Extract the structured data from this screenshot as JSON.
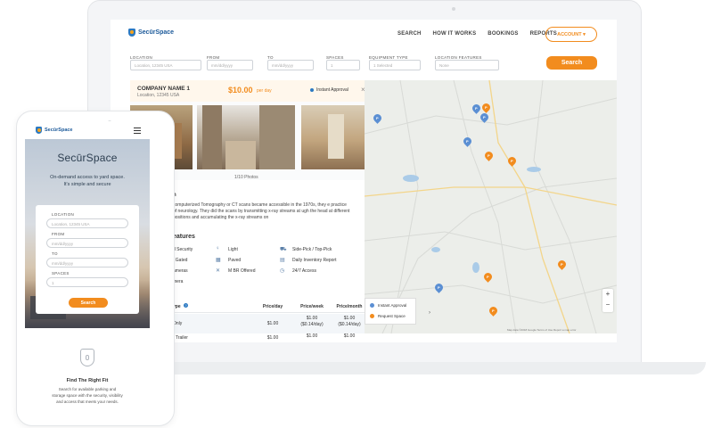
{
  "brand": {
    "name": "SecūrSpace",
    "hero_title": "SecūrSpace",
    "accent": "#f28c1e",
    "blue": "#2b79c2"
  },
  "nav": {
    "search": "SEARCH",
    "how": "HOW IT WORKS",
    "bookings": "BOOKINGS",
    "reports": "REPORTS",
    "account": "ACCOUNT ▾"
  },
  "filters": {
    "location": {
      "label": "LOCATION",
      "placeholder": "Location, 12345 USA"
    },
    "from": {
      "label": "FROM",
      "placeholder": "mm/dd/yyyy"
    },
    "to": {
      "label": "TO",
      "placeholder": "mm/dd/yyyy"
    },
    "spaces": {
      "label": "SPACES",
      "placeholder": "1"
    },
    "equipment": {
      "label": "EQUIPMENT TYPE",
      "placeholder": "1 Selected"
    },
    "features": {
      "label": "LOCATION FEATURES",
      "placeholder": "None"
    },
    "search_button": "Search"
  },
  "listing": {
    "company": "COMPANY NAME 1",
    "location": "Location, 12345 USA",
    "price": "$10.00",
    "price_unit": "per day",
    "instant": "Instant Approval",
    "photo_count": "1/10 Photos",
    "desc_heading_tail": "h",
    "desc": "computerized Tomography or CT scans became accessible in the 1970s, they e practice of neurology. They did the scans by transmitting x-ray streams at ugh the head at different positions and accumulating the x-ray streams on",
    "features_heading": "eatures",
    "features": [
      [
        "d Security",
        "Light",
        "Side-Pick / Top-Pick"
      ],
      [
        "/ Gated",
        "Paved",
        "Daily Inventory Report"
      ],
      [
        "ameras",
        "M BR Offered",
        "24/7 Access"
      ],
      [
        "mera",
        "",
        ""
      ]
    ],
    "table": {
      "headers": [
        "ype",
        "Price/day",
        "Price/week",
        "Price/month"
      ],
      "rows": [
        {
          "name": "Only",
          "day": "$1.00",
          "week": "$1.00",
          "week_sub": "($0.14/day)",
          "month": "$1.00",
          "month_sub": "($0.14/day)"
        },
        {
          "name": "r Trailer",
          "day": "$1.00",
          "week": "$1.00",
          "week_sub": "",
          "month": "$1.00",
          "month_sub": ""
        }
      ]
    }
  },
  "map": {
    "legend_instant": "Instant Approval",
    "legend_request": "Request Space",
    "zoom_in": "+",
    "zoom_out": "−",
    "attribution": "Map data ©2018 Google   Terms of Use   Report a map error"
  },
  "mobile": {
    "tagline1": "On-demand access to yard space.",
    "tagline2": "It's simple and secure",
    "location_label": "LOCATION",
    "location_ph": "Location, 12345 USA",
    "from_label": "FROM",
    "from_ph": "mm/dd/yyyy",
    "to_label": "TO",
    "to_ph": "mm/dd/yyyy",
    "spaces_label": "SPACES",
    "spaces_ph": "1",
    "search": "Search",
    "fit_title": "Find The Right Fit",
    "fit_desc1": "Search for available parking and",
    "fit_desc2": "storage space with the security, visibility",
    "fit_desc3": "and access that meets your needs."
  }
}
